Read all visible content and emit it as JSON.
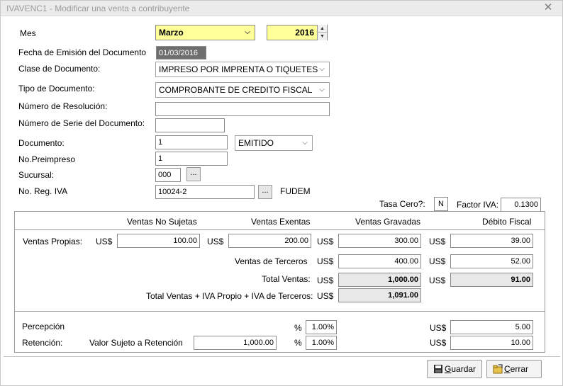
{
  "window": {
    "title": "IVAVENC1 - Modificar una venta a contribuyente"
  },
  "mes": {
    "label": "Mes",
    "value": "Marzo",
    "year": "2016"
  },
  "fecha": {
    "label": "Fecha de Emisión del Documento",
    "value": "01/03/2016"
  },
  "clase": {
    "label": "Clase de Documento:",
    "value": "IMPRESO POR IMPRENTA O TIQUETES"
  },
  "tipo": {
    "label": "Tipo de Documento:",
    "value": "COMPROBANTE DE CREDITO FISCAL"
  },
  "resolucion": {
    "label": "Número de Resolución:",
    "value": ""
  },
  "serie": {
    "label": "Número de Serie del Documento:",
    "value": ""
  },
  "documento": {
    "label": "Documento:",
    "value": "1",
    "estado": "EMITIDO"
  },
  "preimpreso": {
    "label": "No.Preimpreso",
    "value": "1"
  },
  "sucursal": {
    "label": "Sucursal:",
    "value": "000",
    "button": "..."
  },
  "reg_iva": {
    "label": "No. Reg. IVA",
    "value": "10024-2",
    "button": "...",
    "name": "FUDEM"
  },
  "tasa_cero": {
    "label": "Tasa Cero?:",
    "value": "N"
  },
  "factor_iva": {
    "label": "Factor IVA:",
    "value": "0.1300"
  },
  "table": {
    "headers": {
      "no_sujetas": "Ventas No Sujetas",
      "exentas": "Ventas Exentas",
      "gravadas": "Ventas Gravadas",
      "debito": "Débito Fiscal"
    },
    "currency": "US$",
    "propias": {
      "label": "Ventas Propias:",
      "no_sujetas": "100.00",
      "exentas": "200.00",
      "gravadas": "300.00",
      "debito": "39.00"
    },
    "terceros": {
      "label": "Ventas de Terceros",
      "gravadas": "400.00",
      "debito": "52.00"
    },
    "total": {
      "label": "Total Ventas:",
      "gravadas": "1,000.00",
      "debito": "91.00"
    },
    "total_iva": {
      "label": "Total Ventas + IVA Propio + IVA de Terceros:",
      "value": "1,091.00"
    }
  },
  "percepcion": {
    "label": "Percepción",
    "pct_symbol": "%",
    "pct": "1.00%",
    "currency": "US$",
    "value": "5.00"
  },
  "retencion": {
    "label": "Retención:",
    "sujeto_label": "Valor Sujeto a Retención",
    "sujeto_value": "1,000.00",
    "pct_symbol": "%",
    "pct": "1.00%",
    "currency": "US$",
    "value": "10.00"
  },
  "buttons": {
    "guardar_first": "G",
    "guardar_rest": "uardar",
    "cerrar_first": "C",
    "cerrar_rest": "errar"
  },
  "icons": {
    "close": "close-icon",
    "save": "floppy-disk-icon",
    "exit": "folder-exit-icon"
  }
}
